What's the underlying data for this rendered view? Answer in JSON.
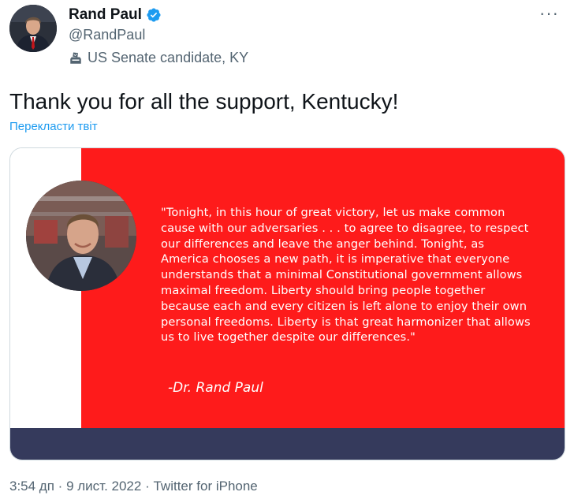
{
  "author": {
    "display_name": "Rand Paul",
    "handle": "@RandPaul",
    "label": "US Senate candidate, KY",
    "label_icon": "ballot-box-icon",
    "verified": true
  },
  "tweet": {
    "text": "Thank you for all the support, Kentucky!",
    "translate_link": "Перекласти твіт"
  },
  "media": {
    "quote_lines": [
      "\"Tonight, in this hour of great victory, let us make common",
      "cause with our adversaries . . . to agree to disagree, to respect",
      "our differences and leave the anger behind. Tonight, as",
      "America chooses a new path, it is imperative that everyone",
      "understands that a minimal Constitutional government allows",
      "maximal freedom. Liberty should bring people together",
      "because each and every citizen is left alone to enjoy their own",
      "personal freedoms. Liberty is that great harmonizer that allows",
      "us to live together despite our differences.\""
    ],
    "attribution": "-Dr. Rand Paul"
  },
  "meta": {
    "time": "3:54 дп",
    "separator": "·",
    "date": "9 лист. 2022",
    "source": "Twitter for iPhone"
  },
  "colors": {
    "accent": "#1d9bf0",
    "red_panel": "#fe1b1b",
    "navy_band": "#353a5c",
    "secondary_text": "#536471"
  }
}
